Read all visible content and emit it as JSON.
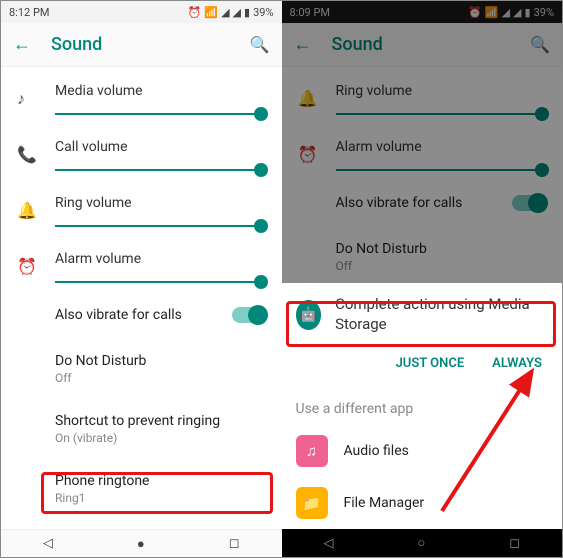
{
  "left": {
    "status": {
      "time": "8:12 PM",
      "battery": "39%"
    },
    "appbar": {
      "title": "Sound"
    },
    "sliders": [
      {
        "icon": "♪",
        "label": "Media volume",
        "pct": 98
      },
      {
        "icon": "📞",
        "label": "Call volume",
        "pct": 98
      },
      {
        "icon": "🔔",
        "label": "Ring volume",
        "pct": 98
      },
      {
        "icon": "⏰",
        "label": "Alarm volume",
        "pct": 98
      }
    ],
    "toggle": {
      "label": "Also vibrate for calls",
      "on": true
    },
    "rows": [
      {
        "primary": "Do Not Disturb",
        "secondary": "Off"
      },
      {
        "primary": "Shortcut to prevent ringing",
        "secondary": "On (vibrate)"
      },
      {
        "primary": "Phone ringtone",
        "secondary": "Ring1"
      }
    ]
  },
  "right": {
    "status": {
      "time": "8:09 PM",
      "battery": "39%"
    },
    "appbar": {
      "title": "Sound"
    },
    "sliders": [
      {
        "icon": "🔔",
        "label": "Ring volume",
        "pct": 98
      },
      {
        "icon": "⏰",
        "label": "Alarm volume",
        "pct": 98
      }
    ],
    "toggle": {
      "label": "Also vibrate for calls",
      "on": true
    },
    "rows": [
      {
        "primary": "Do Not Disturb",
        "secondary": "Off"
      }
    ],
    "sheet": {
      "title": "Complete action using Media Storage",
      "just_once": "JUST ONCE",
      "always": "ALWAYS",
      "different": "Use a different app",
      "apps": [
        {
          "name": "Audio files",
          "color": "pink",
          "glyph": "♫"
        },
        {
          "name": "File Manager",
          "color": "yellow",
          "glyph": "📁"
        }
      ]
    }
  }
}
